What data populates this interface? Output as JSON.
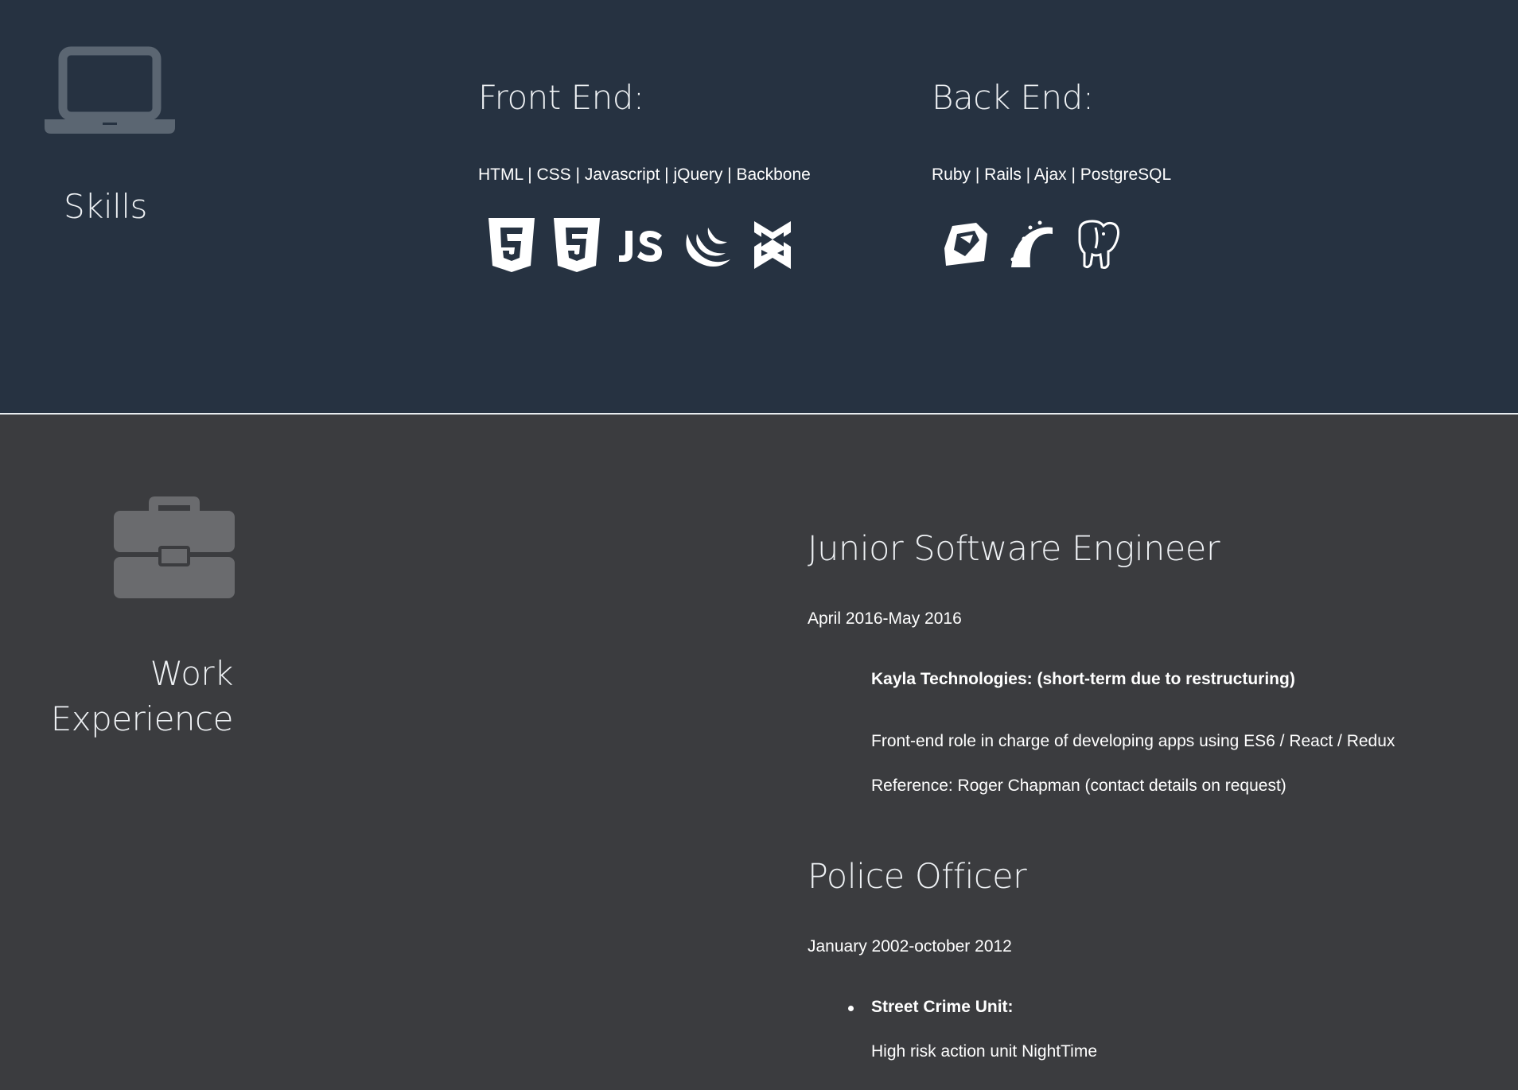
{
  "skills": {
    "title": "Skills",
    "icon": "laptop-icon",
    "front_end": {
      "title": "Front End:",
      "list": "HTML | CSS | Javascript | jQuery | Backbone",
      "icons": [
        "html5-icon",
        "css3-icon",
        "js-icon",
        "jquery-icon",
        "backbone-icon"
      ]
    },
    "back_end": {
      "title": "Back End:",
      "list": "Ruby | Rails | Ajax | PostgreSQL",
      "icons": [
        "ruby-icon",
        "rails-icon",
        "postgresql-icon"
      ]
    }
  },
  "work": {
    "title_line1": "Work",
    "title_line2": "Experience",
    "icon": "briefcase-icon",
    "jobs": [
      {
        "title": "Junior Software Engineer",
        "dates": "April 2016-May 2016",
        "company": "Kayla Technologies: (short-term due to restructuring)",
        "description": "Front-end role in charge of developing apps using ES6 / React / Redux",
        "reference": "Reference: Roger Chapman (contact details on request)"
      },
      {
        "title": "Police Officer",
        "dates": "January 2002-october 2012",
        "unit": "Street Crime Unit:",
        "unit_description": "High risk action unit NightTime"
      }
    ]
  },
  "colors": {
    "skills_bg": "#263241",
    "work_bg": "#3b3c3f",
    "skills_icon": "#5b6672",
    "work_icon": "#6a6b6e",
    "text": "#ffffff"
  }
}
